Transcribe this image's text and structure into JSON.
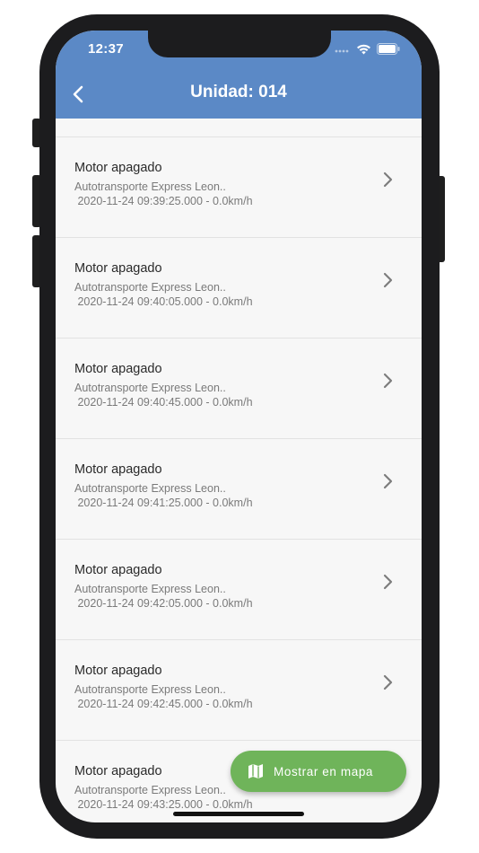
{
  "status_bar": {
    "time": "12:37"
  },
  "app_bar": {
    "back_icon": "chevron-left-icon",
    "title": "Unidad: 014"
  },
  "items": [
    {
      "title": "Motor apagado",
      "company": "Autotransporte Express Leon..",
      "detail": " 2020-11-24 09:39:25.000 - 0.0km/h"
    },
    {
      "title": "Motor apagado",
      "company": "Autotransporte Express Leon..",
      "detail": " 2020-11-24 09:40:05.000 - 0.0km/h"
    },
    {
      "title": "Motor apagado",
      "company": "Autotransporte Express Leon..",
      "detail": " 2020-11-24 09:40:45.000 - 0.0km/h"
    },
    {
      "title": "Motor apagado",
      "company": "Autotransporte Express Leon..",
      "detail": " 2020-11-24 09:41:25.000 - 0.0km/h"
    },
    {
      "title": "Motor apagado",
      "company": "Autotransporte Express Leon..",
      "detail": " 2020-11-24 09:42:05.000 - 0.0km/h"
    },
    {
      "title": "Motor apagado",
      "company": "Autotransporte Express Leon..",
      "detail": " 2020-11-24 09:42:45.000 - 0.0km/h"
    },
    {
      "title": "Motor apagado",
      "company": "Autotransporte Express Leon..",
      "detail": " 2020-11-24 09:43:25.000 - 0.0km/h"
    }
  ],
  "fab": {
    "icon": "map-icon",
    "label": "Mostrar en mapa"
  },
  "colors": {
    "app_bar": "#5b89c6",
    "fab": "#6fb45a",
    "list_background": "#f7f7f7"
  }
}
